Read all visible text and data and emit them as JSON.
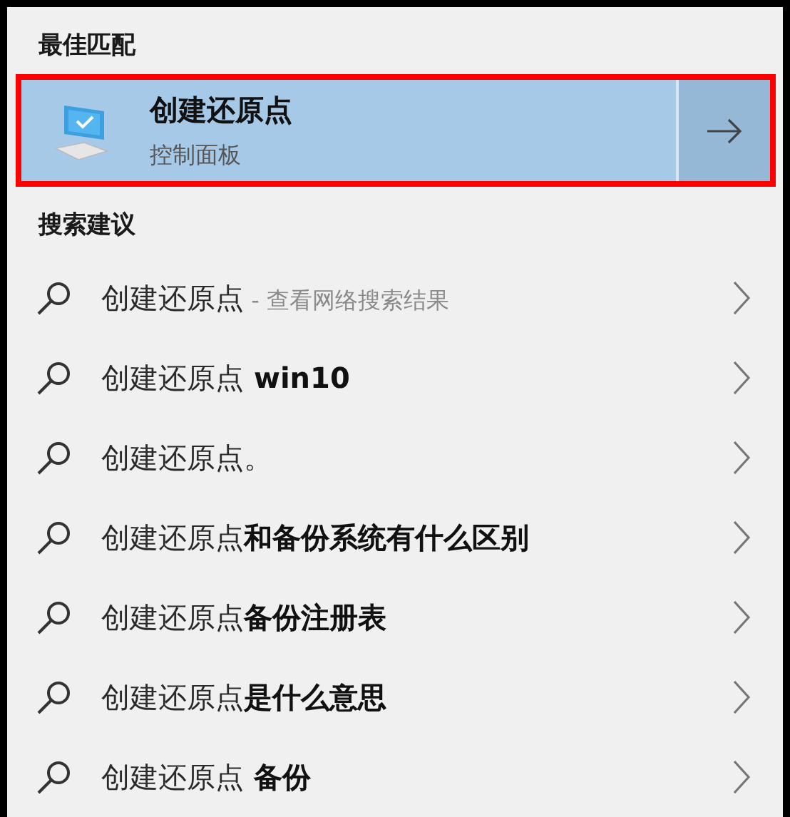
{
  "best_match": {
    "heading": "最佳匹配",
    "highlighted": true,
    "title": "创建还原点",
    "subtitle": "控制面板"
  },
  "suggestions": {
    "heading": "搜索建议",
    "items": [
      {
        "kind": "web",
        "query": "创建还原点",
        "suffix": "- 查看网络搜索结果"
      },
      {
        "kind": "bold",
        "query": "创建还原点",
        "suffix": " win10"
      },
      {
        "kind": "plain",
        "query": "创建还原点",
        "suffix": "。"
      },
      {
        "kind": "bold",
        "query": "创建还原点",
        "suffix": "和备份系统有什么区别"
      },
      {
        "kind": "bold",
        "query": "创建还原点",
        "suffix": "备份注册表"
      },
      {
        "kind": "bold",
        "query": "创建还原点",
        "suffix": "是什么意思"
      },
      {
        "kind": "bold",
        "query": "创建还原点",
        "suffix": " 备份"
      }
    ]
  }
}
